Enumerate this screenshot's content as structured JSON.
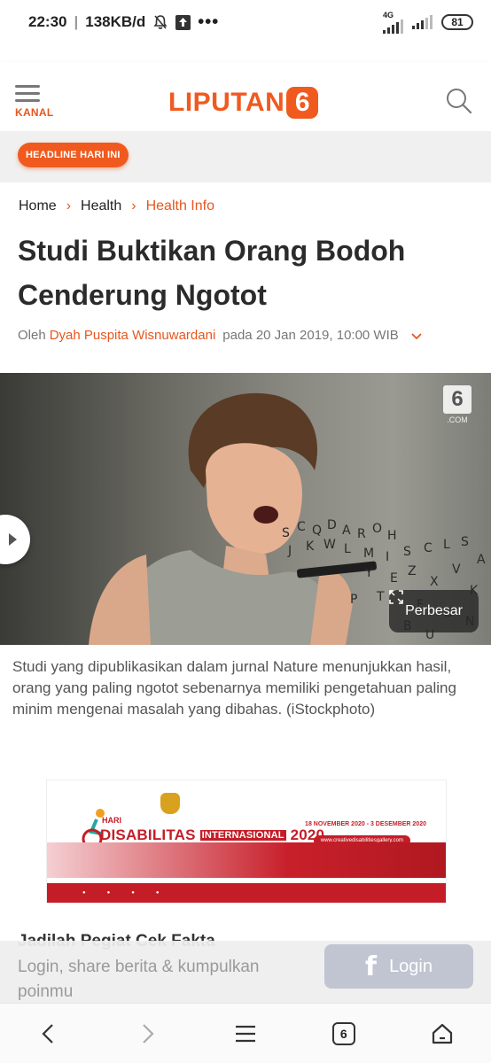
{
  "status_bar": {
    "time": "22:30",
    "speed": "138KB/d",
    "network_label": "4G",
    "battery": "81",
    "icons": [
      "mute-bell-icon",
      "upload-icon",
      "more-dots-icon",
      "signal-icon",
      "battery-icon"
    ]
  },
  "header": {
    "menu_label": "KANAL",
    "logo_text": "LIPUTAN",
    "logo_digit": "6",
    "accent_color": "#f05a1f"
  },
  "headline_pill": "HEADLINE HARI INI",
  "breadcrumb": [
    "Home",
    "Health",
    "Health Info"
  ],
  "article": {
    "title": "Studi Buktikan Orang Bodoh Cenderung Ngotot",
    "byline_prefix": "Oleh",
    "author": "Dyah Puspita Wisnuwardani",
    "date": "pada 20 Jan 2019, 10:00 WIB",
    "image_watermark": "6",
    "image_watermark_suffix": ".COM",
    "enlarge_label": "Perbesar",
    "caption": "Studi yang dipublikasikan dalam jurnal Nature menunjukkan hasil, orang yang paling ngotot sebenarnya memiliki pengetahuan paling minim mengenai masalah yang dibahas. (iStockphoto)"
  },
  "ad": {
    "hari": "HARI",
    "title_main": "DISABILITAS",
    "title_intl": "INTERNASIONAL",
    "year": "2020",
    "dates": "18 NOVEMBER 2020 - 3 DESEMBER 2020",
    "site": "www.creativedisabilitiesgallery.com"
  },
  "next_heading": "Jadilah Pegiat Cek Fakta",
  "login_prompt": {
    "message": "Login, share berita & kumpulkan poinmu",
    "button_label": "Login",
    "button_icon": "f"
  },
  "nav": {
    "tab_count": "6"
  }
}
